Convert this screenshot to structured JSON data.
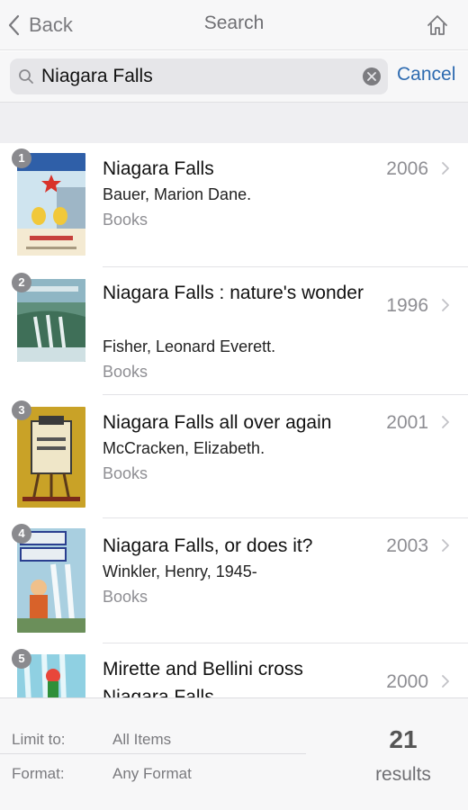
{
  "nav": {
    "back_label": "Back",
    "title": "Search"
  },
  "search": {
    "query": "Niagara Falls",
    "cancel_label": "Cancel"
  },
  "results": [
    {
      "rank": "1",
      "title": "Niagara Falls",
      "author": "Bauer, Marion Dane.",
      "format": "Books",
      "year": "2006"
    },
    {
      "rank": "2",
      "title": "Niagara Falls : nature's wonder",
      "author": "Fisher, Leonard Everett.",
      "format": "Books",
      "year": "1996"
    },
    {
      "rank": "3",
      "title": "Niagara Falls all over again",
      "author": "McCracken, Elizabeth.",
      "format": "Books",
      "year": "2001"
    },
    {
      "rank": "4",
      "title": "Niagara Falls, or does it?",
      "author": "Winkler, Henry, 1945-",
      "format": "Books",
      "year": "2003"
    },
    {
      "rank": "5",
      "title": "Mirette and Bellini cross Niagara Falls",
      "year": "2000"
    }
  ],
  "filters": {
    "limit_label": "Limit to:",
    "limit_value": "All Items",
    "format_label": "Format:",
    "format_value": "Any Format"
  },
  "summary": {
    "count": "21",
    "label": "results"
  },
  "colors": {
    "accent": "#2e6bb0",
    "badge": "#8a8a8e",
    "secondary_text": "#8e8e93"
  }
}
